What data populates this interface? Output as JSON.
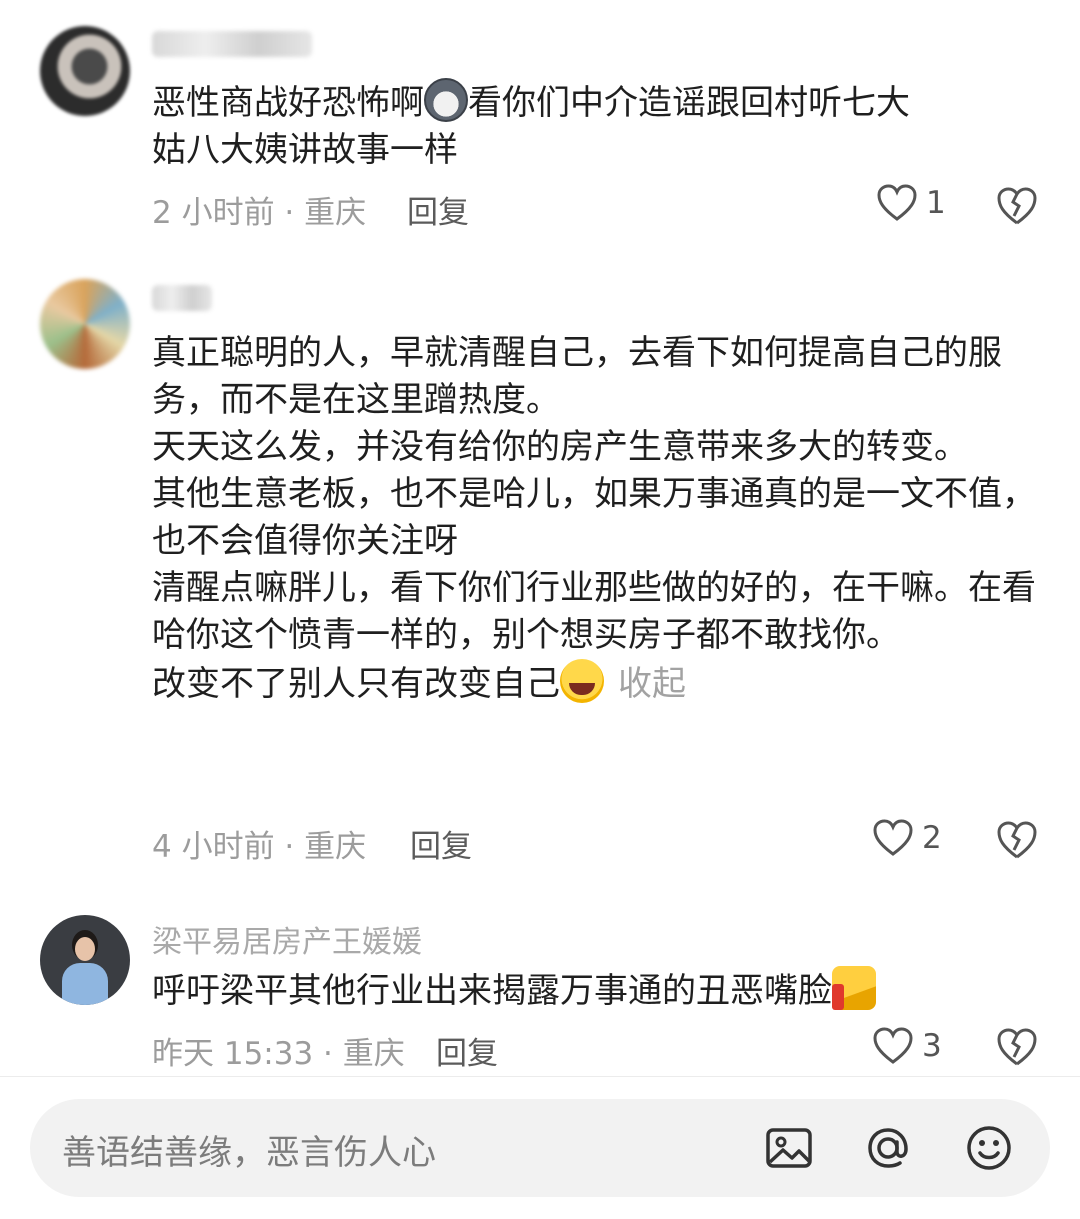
{
  "comments": [
    {
      "username": "",
      "text_lines": [
        "恶性商战好恐怖啊",
        "看你们中介造谣跟回村听七大",
        "姑八大姨讲故事一样"
      ],
      "time_location": "2 小时前 · 重庆",
      "reply_label": "回复",
      "like_count": "1"
    },
    {
      "username": "",
      "paragraphs": [
        "真正聪明的人，早就清醒自己，去看下如何提高自己的服务，而不是在这里蹭热度。",
        "天天这么发，并没有给你的房产生意带来多大的转变。",
        "其他生意老板，也不是哈儿，如果万事通真的是一文不值，也不会值得你关注呀",
        "清醒点嘛胖儿，看下你们行业那些做的好的，在干嘛。在看哈你这个愤青一样的，别个想买房子都不敢找你。",
        "改变不了别人只有改变自己"
      ],
      "collapse_label": "收起",
      "time_location": "4 小时前 · 重庆",
      "reply_label": "回复",
      "like_count": "2"
    },
    {
      "username": "梁平易居房产王媛媛",
      "text": "呼吁梁平其他行业出来揭露万事通的丑恶嘴脸",
      "time_location": "昨天 15:33 · 重庆",
      "reply_label": "回复",
      "like_count": "3"
    }
  ],
  "input": {
    "placeholder": "善语结善缘，恶言伤人心"
  },
  "icons": {
    "like": "heart-outline-icon",
    "dislike": "broken-heart-icon",
    "image": "image-icon",
    "mention": "at-icon",
    "emoji": "smiley-icon"
  }
}
